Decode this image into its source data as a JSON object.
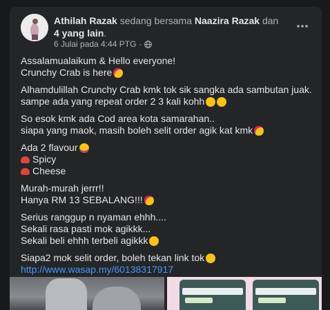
{
  "post": {
    "author": "Athilah Razak",
    "with_text": "sedang bersama",
    "tagged": "Naazira Razak",
    "and_text": "dan",
    "others": "4 yang lain",
    "period": ".",
    "date": "6 Julai pada 4:44 PTG",
    "dot": "·",
    "icons": {
      "more": "more-options-icon",
      "privacy": "globe-icon"
    },
    "paragraphs": [
      {
        "lines": [
          {
            "text": "Assalamualaikum & Hello everyone!"
          },
          {
            "text": "Crunchy Crab is here",
            "emoji": "heart-eyes-emoji"
          }
        ]
      },
      {
        "lines": [
          {
            "text": "Alhamdulillah Crunchy Crab kmk tok sik sangka ada sambutan juak."
          },
          {
            "text": "sampe ada yang repeat order 2 3 kali kohh",
            "emoji": "grimacing-face-emoji",
            "emoji2": "smirk-emoji"
          }
        ]
      },
      {
        "lines": [
          {
            "text": "So esok kmk ada Cod area kota samarahan.."
          },
          {
            "text": "siapa yang maok, masih boleh selit order agik kat kmk",
            "emoji": "face-blowing-kiss-emoji"
          }
        ]
      },
      {
        "lines": [
          {
            "text": "Ada 2 flavour",
            "emoji": "star-struck-emoji"
          },
          {
            "text": "Spicy",
            "crab": true
          },
          {
            "text": "Cheese",
            "crab": true
          }
        ]
      },
      {
        "lines": [
          {
            "text": "Murah-murah jerrr!!"
          },
          {
            "text": "Hanya RM 13 SEBALANG!!!",
            "emoji": "heart-eyes-emoji"
          }
        ]
      },
      {
        "lines": [
          {
            "text": "Serius ranggup n nyaman ehhh...."
          },
          {
            "text": "Sekali rasa pasti mok agikkk..."
          },
          {
            "text": "Sekali beli ehhh terbeli agikkk",
            "emoji": "grimacing-face-emoji"
          }
        ]
      },
      {
        "lines": [
          {
            "text": "Siapa2 mok selit order, boleh tekan link tok",
            "emoji": "smirk-emoji"
          },
          {
            "text": "http://www.wasap.my/60138317917",
            "link": true
          }
        ]
      }
    ]
  },
  "colors": {
    "background": "#18191a",
    "card": "#242526",
    "text_primary": "#e4e6eb",
    "text_secondary": "#b0b3b8",
    "link": "#4599ff"
  }
}
